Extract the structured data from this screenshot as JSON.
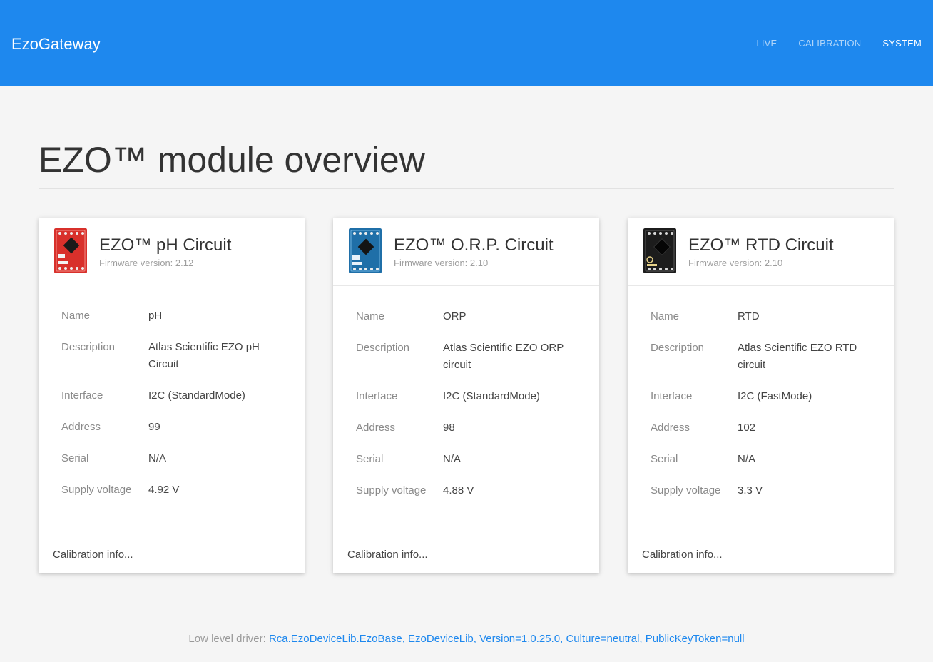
{
  "navbar": {
    "brand": "EzoGateway",
    "links": [
      "LIVE",
      "CALIBRATION",
      "SYSTEM"
    ],
    "active": "SYSTEM",
    "color": "#1e88ee"
  },
  "page": {
    "title": "EZO™ module overview"
  },
  "labels": {
    "name": "Name",
    "description": "Description",
    "interface": "Interface",
    "address": "Address",
    "serial": "Serial",
    "supply_voltage": "Supply voltage"
  },
  "cards": [
    {
      "title": "EZO™ pH Circuit",
      "firmware": "Firmware version: 2.12",
      "image_icon": "ph-circuit-board-image",
      "board_color": "#d8302b",
      "name": "pH",
      "description": "Atlas Scientific EZO pH Circuit",
      "interface": "I2C (StandardMode)",
      "address": "99",
      "serial": "N/A",
      "supply_voltage": "4.92 V",
      "footer_link": "Calibration info..."
    },
    {
      "title": "EZO™ O.R.P. Circuit",
      "firmware": "Firmware version: 2.10",
      "image_icon": "orp-circuit-board-image",
      "board_color": "#1f6fa8",
      "name": "ORP",
      "description": "Atlas Scientific EZO ORP circuit",
      "interface": "I2C (StandardMode)",
      "address": "98",
      "serial": "N/A",
      "supply_voltage": "4.88 V",
      "footer_link": "Calibration info..."
    },
    {
      "title": "EZO™ RTD Circuit",
      "firmware": "Firmware version: 2.10",
      "image_icon": "rtd-circuit-board-image",
      "board_color": "#1c1c1c",
      "name": "RTD",
      "description": "Atlas Scientific EZO RTD circuit",
      "interface": "I2C (FastMode)",
      "address": "102",
      "serial": "N/A",
      "supply_voltage": "3.3 V",
      "footer_link": "Calibration info..."
    }
  ],
  "footer": {
    "label": "Low level driver: ",
    "driver": "Rca.EzoDeviceLib.EzoBase, EzoDeviceLib, Version=1.0.25.0, Culture=neutral, PublicKeyToken=null",
    "link_color": "#1e88ee"
  }
}
